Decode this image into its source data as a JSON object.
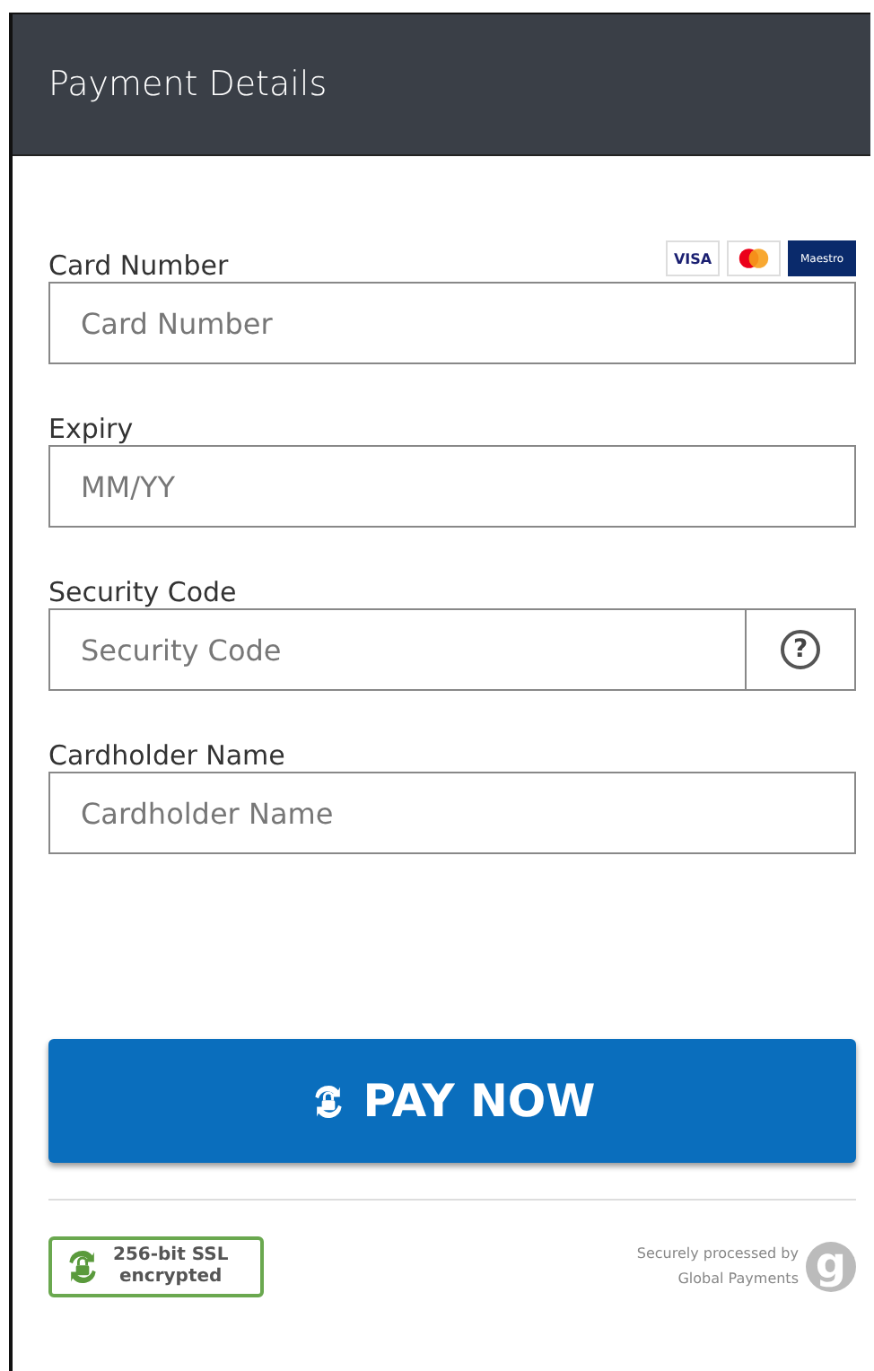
{
  "header": {
    "title": "Payment Details"
  },
  "card_logos": [
    {
      "kind": "visa",
      "label": "VISA"
    },
    {
      "kind": "mastercard"
    },
    {
      "kind": "maestro",
      "label": "Maestro"
    }
  ],
  "fields": [
    {
      "label": "Card Number",
      "placeholder": "Card Number",
      "kind": "text"
    },
    {
      "label": "Expiry",
      "placeholder": "MM/YY",
      "kind": "text"
    },
    {
      "label": "Security Code",
      "placeholder": "Security Code",
      "kind": "help",
      "help": "?"
    },
    {
      "label": "Cardholder Name",
      "placeholder": "Cardholder Name",
      "kind": "text"
    }
  ],
  "pay_button": {
    "label": "PAY NOW"
  },
  "ssl_badge": {
    "lines": [
      "256-bit SSL",
      "encrypted"
    ]
  },
  "processor": {
    "lines": [
      "Securely processed by",
      "Global Payments"
    ],
    "logo_letter": "g"
  }
}
